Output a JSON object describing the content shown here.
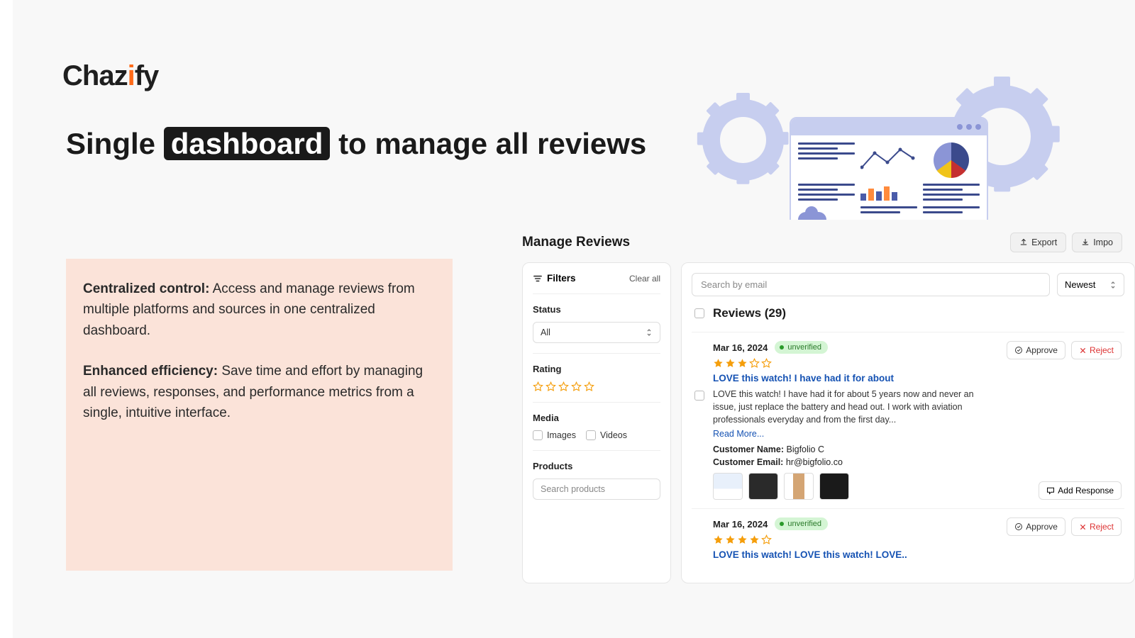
{
  "brand": {
    "name_prefix": "Chaz",
    "name_accent": "i",
    "name_suffix": "fy"
  },
  "headline": {
    "part1": "Single ",
    "highlight": "dashboard",
    "part2": " to manage all reviews"
  },
  "copy": {
    "block1_label": "Centralized control:",
    "block1_text": " Access and manage reviews from multiple platforms and sources in one centralized dashboard.",
    "block2_label": "Enhanced efficiency:",
    "block2_text": " Save time and effort by managing all reviews, responses, and performance metrics from a single, intuitive interface."
  },
  "dash": {
    "title": "Manage Reviews",
    "export": "Export",
    "import": "Impo",
    "filters": {
      "label": "Filters",
      "clear": "Clear all",
      "status_label": "Status",
      "status_value": "All",
      "rating_label": "Rating",
      "media_label": "Media",
      "media_images": "Images",
      "media_videos": "Videos",
      "products_label": "Products",
      "products_placeholder": "Search products"
    },
    "search_placeholder": "Search by email",
    "sort_value": "Newest",
    "reviews_count_label": "Reviews (29)",
    "approve": "Approve",
    "reject": "Reject",
    "add_response": "Add Response",
    "read_more": "Read More...",
    "reviews": [
      {
        "date": "Mar 16, 2024",
        "badge": "unverified",
        "stars": 3,
        "title": "LOVE this watch! I have had it for about",
        "body": "LOVE this watch! I have had it for about 5 years now and never an issue, just replace the battery and head out. I work with aviation professionals everyday and from the first day...",
        "customer_name_label": "Customer Name:",
        "customer_name": "Bigfolio C",
        "customer_email_label": "Customer Email:",
        "customer_email": "hr@bigfolio.co"
      },
      {
        "date": "Mar 16, 2024",
        "badge": "unverified",
        "stars": 4,
        "title": "LOVE this watch! LOVE this watch! LOVE.."
      }
    ]
  }
}
